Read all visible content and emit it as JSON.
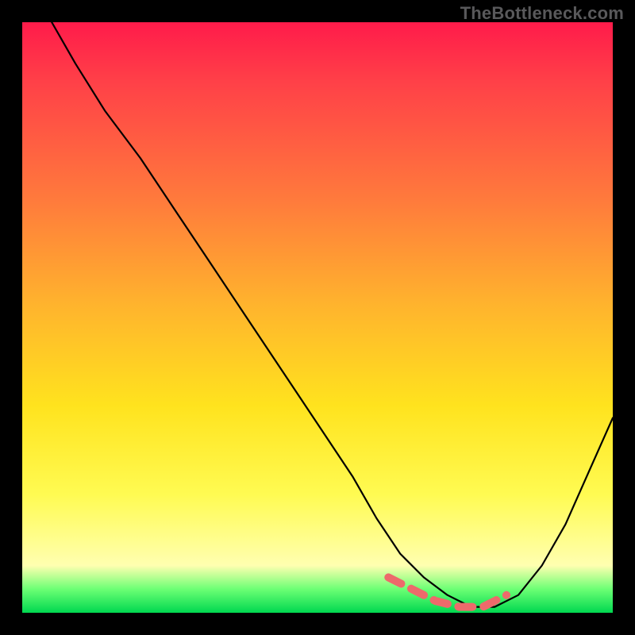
{
  "watermark": "TheBottleneck.com",
  "chart_data": {
    "type": "line",
    "title": "",
    "xlabel": "",
    "ylabel": "",
    "xlim": [
      0,
      100
    ],
    "ylim": [
      0,
      100
    ],
    "grid": false,
    "legend": false,
    "series": [
      {
        "name": "bottleneck-curve",
        "x": [
          5,
          9,
          14,
          20,
          26,
          32,
          38,
          44,
          50,
          56,
          60,
          64,
          68,
          72,
          76,
          80,
          84,
          88,
          92,
          96,
          100
        ],
        "y": [
          100,
          93,
          85,
          77,
          68,
          59,
          50,
          41,
          32,
          23,
          16,
          10,
          6,
          3,
          1,
          1,
          3,
          8,
          15,
          24,
          33
        ]
      }
    ],
    "markers": {
      "name": "optimal-band",
      "style": "dashed",
      "color": "#ed6a6b",
      "x": [
        62,
        66,
        70,
        74,
        78,
        82
      ],
      "y": [
        6,
        4,
        2,
        1,
        1,
        3
      ]
    },
    "background_gradient": {
      "top": "#ff1b4a",
      "upper_mid": "#ffb42d",
      "mid": "#fffb52",
      "lower": "#00d850"
    }
  }
}
